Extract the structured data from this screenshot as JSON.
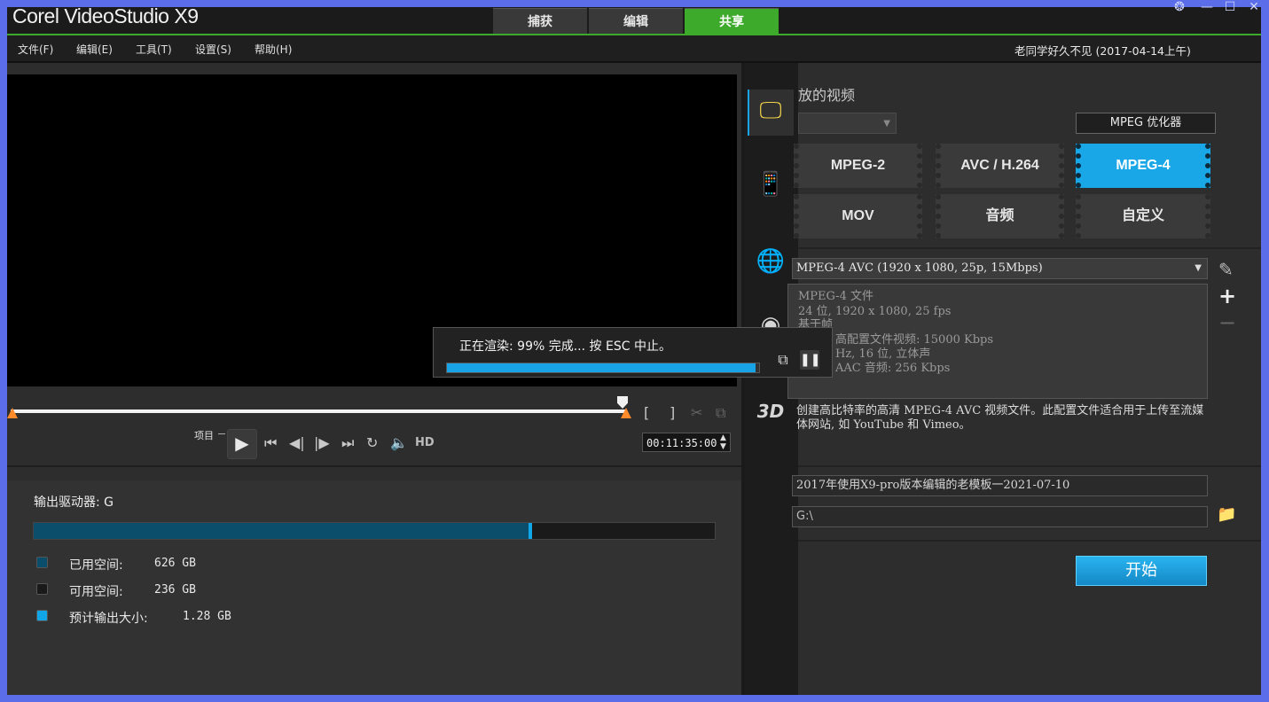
{
  "app": {
    "brand": "Corel VideoStudio X9",
    "tabs": [
      {
        "label": "捕获"
      },
      {
        "label": "编辑"
      },
      {
        "label": "共享"
      }
    ],
    "active_tab": "共享"
  },
  "menu": [
    "文件(F)",
    "编辑(E)",
    "工具(T)",
    "设置(S)",
    "帮助(H)"
  ],
  "project_info": "老同学好久不见 (2017-04-14上午)",
  "player": {
    "project_label": "项目",
    "hd_label": "HD",
    "timecode": "00:11:35:00",
    "mark_in": "[",
    "mark_out": "]"
  },
  "render": {
    "status": "正在渲染: 99% 完成... 按 ESC 中止。",
    "progress_percent": 99
  },
  "disk": {
    "drive_label": "输出驱动器: G",
    "used_fraction": 0.726,
    "output_fraction": 0.004,
    "legend": [
      {
        "label": "已用空间:",
        "value": "626 GB",
        "color": "#0a4e6b"
      },
      {
        "label": "可用空间:",
        "value": "236 GB",
        "color": "#1a1a1a"
      },
      {
        "label": "预计输出大小:",
        "value": "1.28 GB",
        "color": "#11a6e8"
      }
    ]
  },
  "share": {
    "section_title": "放的视频",
    "mpeg_optimizer": "MPEG 优化器",
    "formats": [
      "MPEG-2",
      "AVC / H.264",
      "MPEG-4",
      "MOV",
      "音频",
      "自定义"
    ],
    "active_format": "MPEG-4",
    "profile": "MPEG-4 AVC (1920 x 1080, 25p, 15Mbps)",
    "details": [
      "MPEG-4 文件",
      "24 位, 1920 x 1080, 25 fps",
      "基于帧",
      "高配置文件视频: 15000 Kbps",
      "Hz, 16 位, 立体声",
      "AAC 音频: 256 Kbps"
    ],
    "description": "创建高比特率的高清 MPEG-4 AVC 视频文件。此配置文件适合用于上传至流媒体网站, 如 YouTube 和 Vimeo。",
    "filename": "2017年使用X9-pro版本编辑的老模板一2021-07-10",
    "path": "G:\\",
    "start_label": "开始"
  },
  "colors": {
    "accent": "#17a3e6",
    "active_tab": "#3eaa2c"
  }
}
